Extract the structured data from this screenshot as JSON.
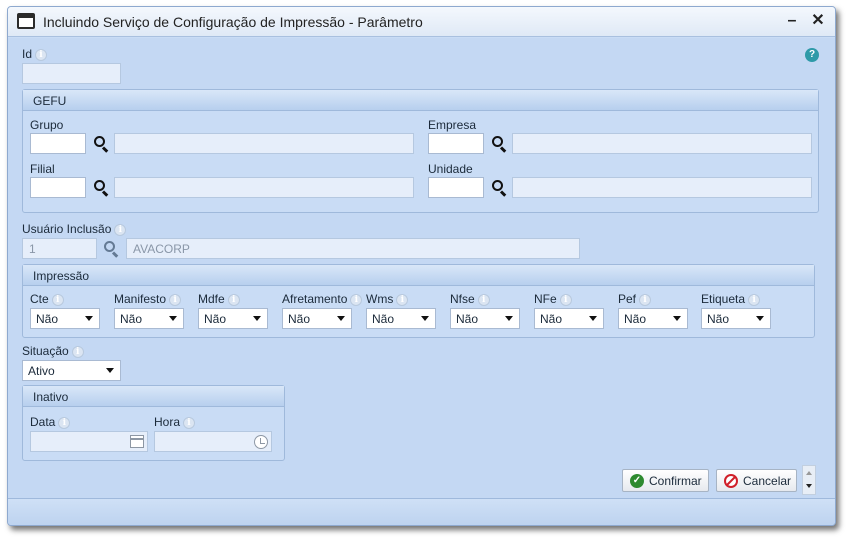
{
  "window": {
    "title": "Incluindo Serviço de Configuração de Impressão - Parâmetro",
    "minimize": "–",
    "close": "✕"
  },
  "help_glyph": "?",
  "info_glyph": "i",
  "id_field": {
    "label": "Id",
    "value": ""
  },
  "gefu": {
    "title": "GEFU",
    "grupo": {
      "label": "Grupo",
      "code": "",
      "desc": ""
    },
    "empresa": {
      "label": "Empresa",
      "code": "",
      "desc": ""
    },
    "filial": {
      "label": "Filial",
      "code": "",
      "desc": ""
    },
    "unidade": {
      "label": "Unidade",
      "code": "",
      "desc": ""
    }
  },
  "usuario": {
    "label": "Usuário Inclusão",
    "code": "1",
    "desc": "AVACORP"
  },
  "impressao": {
    "title": "Impressão",
    "items": [
      {
        "label": "Cte",
        "value": "Não"
      },
      {
        "label": "Manifesto",
        "value": "Não"
      },
      {
        "label": "Mdfe",
        "value": "Não"
      },
      {
        "label": "Afretamento",
        "value": "Não"
      },
      {
        "label": "Wms",
        "value": "Não"
      },
      {
        "label": "Nfse",
        "value": "Não"
      },
      {
        "label": "NFe",
        "value": "Não"
      },
      {
        "label": "Pef",
        "value": "Não"
      },
      {
        "label": "Etiqueta",
        "value": "Não"
      }
    ]
  },
  "situacao": {
    "label": "Situação",
    "value": "Ativo"
  },
  "inativo": {
    "title": "Inativo",
    "data": {
      "label": "Data",
      "value": ""
    },
    "hora": {
      "label": "Hora",
      "value": ""
    }
  },
  "buttons": {
    "confirm": "Confirmar",
    "cancel": "Cancelar"
  },
  "icons": {
    "search": "search-icon",
    "info": "info-icon",
    "help": "help-icon",
    "calendar": "calendar-icon",
    "clock": "clock-icon",
    "confirm": "check-circle-icon",
    "cancel": "ban-icon"
  },
  "colors": {
    "window_bg": "#c4d8f3",
    "titlebar": "#e7eef8",
    "confirm_icon": "#2d8a2f",
    "cancel_icon": "#d0202a",
    "help_icon": "#2e9aa8"
  }
}
